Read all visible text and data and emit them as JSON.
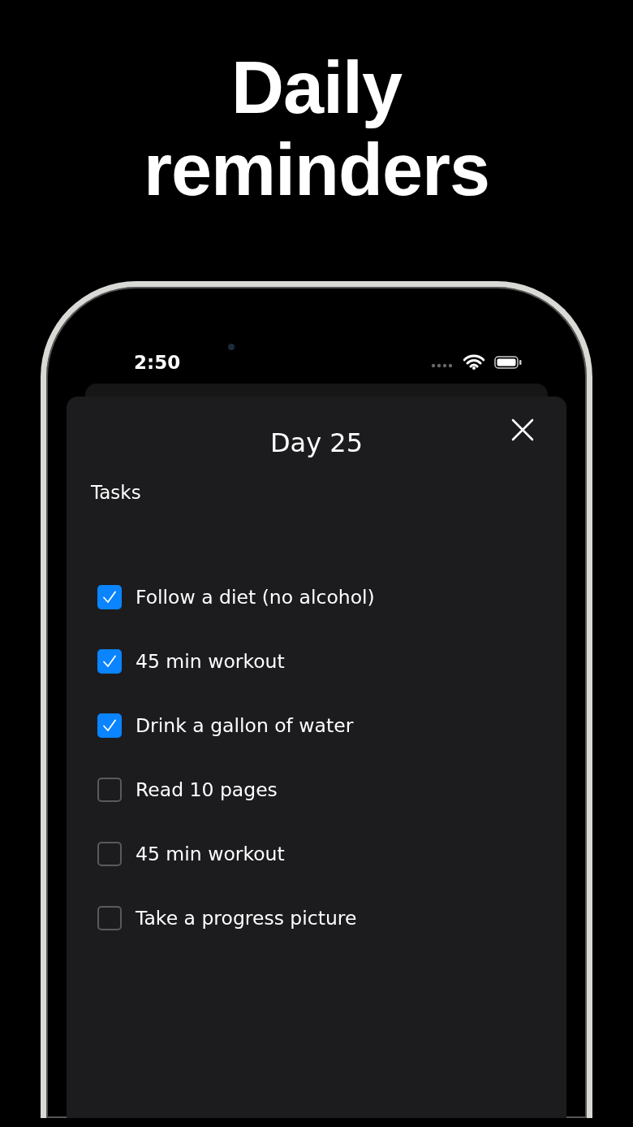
{
  "headline": "Daily reminders",
  "status_bar": {
    "time": "2:50"
  },
  "sheet": {
    "title": "Day 25",
    "section": "Tasks",
    "tasks": [
      {
        "label": "Follow a diet (no alcohol)",
        "checked": true
      },
      {
        "label": "45 min workout",
        "checked": true
      },
      {
        "label": "Drink a gallon of water",
        "checked": true
      },
      {
        "label": "Read 10 pages",
        "checked": false
      },
      {
        "label": "45 min workout",
        "checked": false
      },
      {
        "label": "Take a progress picture",
        "checked": false
      }
    ]
  }
}
